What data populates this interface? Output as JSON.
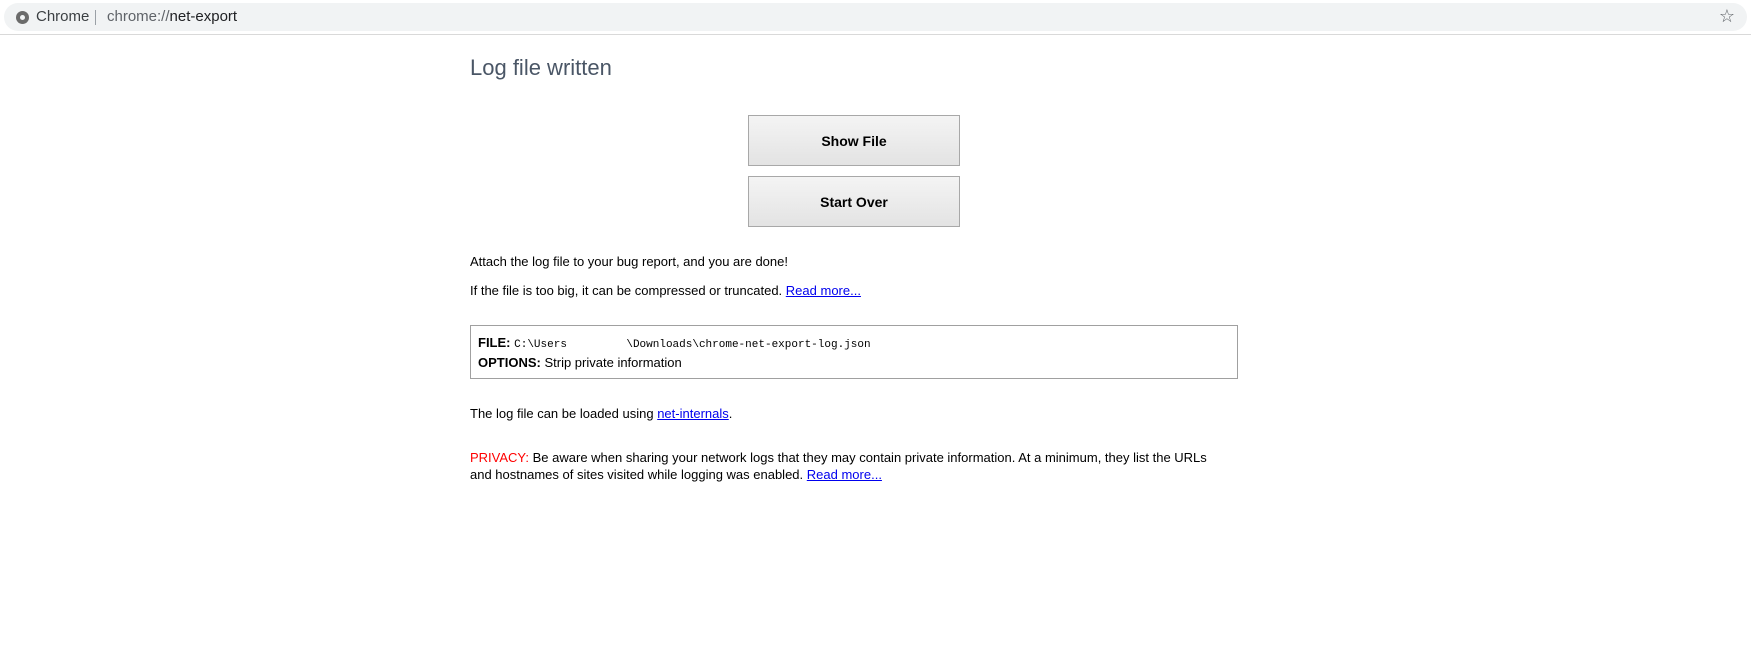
{
  "omnibox": {
    "site_name": "Chrome",
    "url_scheme": "chrome://",
    "url_path": "net-export",
    "star_glyph": "☆",
    "icons": {
      "site": "chrome-page-icon",
      "bookmark": "star-icon"
    }
  },
  "page": {
    "title": "Log file written",
    "show_file_label": "Show File",
    "start_over_label": "Start Over",
    "attach_text": "Attach the log file to your bug report, and you are done!",
    "big_file_text": "If the file is too big, it can be compressed or truncated.",
    "read_more_1": "Read more...",
    "file_label": "FILE:",
    "file_path": "C:\\Users         \\Downloads\\chrome-net-export-log.json",
    "options_label": "OPTIONS:",
    "options_value": "Strip private information",
    "loaded_prefix": "The log file can be loaded using",
    "net_internals_link": "net-internals",
    "loaded_suffix": ".",
    "privacy_label": "PRIVACY:",
    "privacy_text": "Be aware when sharing your network logs that they may contain private information. At a minimum, they list the URLs and hostnames of sites visited while logging was enabled.",
    "read_more_2": "Read more..."
  },
  "colors": {
    "title": "#4a5666",
    "link": "#0000ee",
    "privacy_label": "#ff0000",
    "omnibox_bg": "#f1f3f4"
  }
}
